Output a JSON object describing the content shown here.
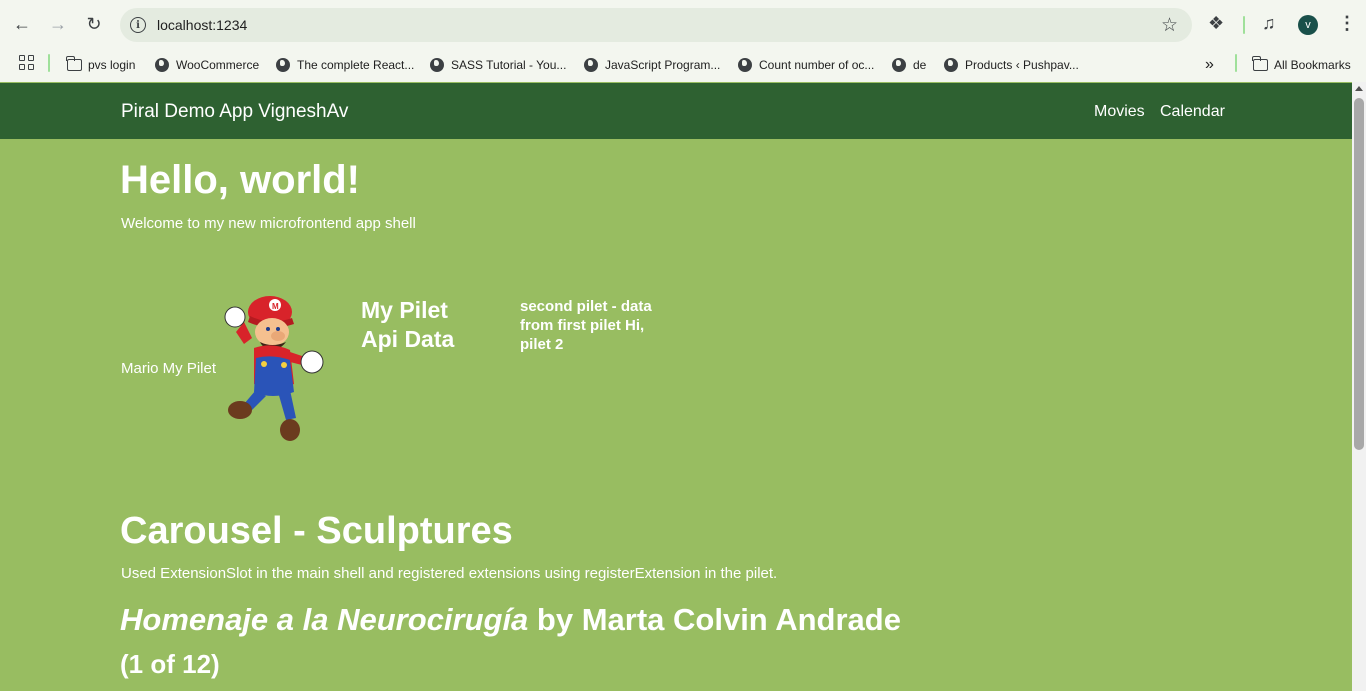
{
  "browser": {
    "url": "localhost:1234",
    "avatar_letter": "v",
    "bookmarks": [
      {
        "label": "pvs login",
        "icon": "folder-icon"
      },
      {
        "label": "WooCommerce",
        "icon": "globe-icon"
      },
      {
        "label": "The complete React...",
        "icon": "globe-icon"
      },
      {
        "label": "SASS Tutorial - You...",
        "icon": "globe-icon"
      },
      {
        "label": "JavaScript Program...",
        "icon": "globe-icon"
      },
      {
        "label": "Count number of oc...",
        "icon": "globe-icon"
      },
      {
        "label": "de",
        "icon": "globe-icon"
      },
      {
        "label": "Products ‹ Pushpav...",
        "icon": "globe-icon"
      }
    ],
    "more_bookmarks": "»",
    "all_bookmarks": "All Bookmarks"
  },
  "app": {
    "brand": "Piral Demo App VigneshAv",
    "nav": [
      "Movies",
      "Calendar"
    ],
    "hero_title": "Hello, world!",
    "hero_subtitle": "Welcome to my new microfrontend app shell",
    "mario_label": "Mario My Pilet",
    "pilet_title_line1": "My Pilet",
    "pilet_title_line2": "Api Data",
    "second_pilet_text": "second pilet - data from first pilet Hi, pilet 2",
    "carousel_title": "Carousel - Sculptures",
    "carousel_subtitle": "Used ExtensionSlot in the main shell and registered extensions using registerExtension in the pilet.",
    "sculpture_name": "Homenaje a la Neurocirugía",
    "sculpture_artist": " by Marta Colvin Andrade",
    "sculpture_count": "(1 of 12)"
  },
  "colors": {
    "page_bg": "#98bd61",
    "navbar_bg": "#2e6131",
    "text": "#ffffff"
  }
}
